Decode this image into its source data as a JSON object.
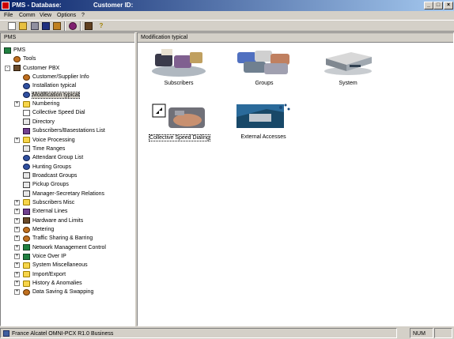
{
  "window": {
    "title": "PMS - Database:",
    "subtitle": "Customer ID:",
    "controls": {
      "minimize": "_",
      "maximize": "□",
      "close": "×"
    }
  },
  "menu": [
    "File",
    "Comm",
    "View",
    "Options",
    "?"
  ],
  "toolbar": {
    "buttons": [
      "new-icon",
      "open-icon",
      "save-icon",
      "save-all-icon",
      "print-icon",
      "disk-icon",
      "book-icon",
      "help-icon"
    ]
  },
  "left_pane": {
    "header": "PMS",
    "tree": [
      {
        "label": "PMS",
        "icon": "pms-icon",
        "level": 0,
        "expander": ""
      },
      {
        "label": "Tools",
        "icon": "tools-icon",
        "level": 1,
        "expander": ""
      },
      {
        "label": "Customer PBX",
        "icon": "pbx-icon",
        "level": 1,
        "expander": "-"
      },
      {
        "label": "Customer/Supplier Info",
        "icon": "gear-icon",
        "level": 2,
        "expander": ""
      },
      {
        "label": "Installation typical",
        "icon": "people-icon",
        "level": 2,
        "expander": ""
      },
      {
        "label": "Modification typical",
        "icon": "people-icon",
        "level": 2,
        "expander": "",
        "selected": true
      },
      {
        "label": "Numbering",
        "icon": "folder-icon",
        "level": 2,
        "expander": "+"
      },
      {
        "label": "Collective Speed Dial",
        "icon": "doc-icon",
        "level": 2,
        "expander": ""
      },
      {
        "label": "Directory",
        "icon": "list-icon",
        "level": 2,
        "expander": ""
      },
      {
        "label": "Subscribers/Basestations List",
        "icon": "phone-icon",
        "level": 2,
        "expander": ""
      },
      {
        "label": "Voice Processing",
        "icon": "folder-icon",
        "level": 2,
        "expander": "+"
      },
      {
        "label": "Time Ranges",
        "icon": "list-icon",
        "level": 2,
        "expander": ""
      },
      {
        "label": "Attendant Group List",
        "icon": "people-icon",
        "level": 2,
        "expander": ""
      },
      {
        "label": "Hunting Groups",
        "icon": "people-icon",
        "level": 2,
        "expander": ""
      },
      {
        "label": "Broadcast Groups",
        "icon": "list-icon",
        "level": 2,
        "expander": ""
      },
      {
        "label": "Pickup Groups",
        "icon": "list-icon",
        "level": 2,
        "expander": ""
      },
      {
        "label": "Manager-Secretary Relations",
        "icon": "list-icon",
        "level": 2,
        "expander": ""
      },
      {
        "label": "Subscribers Misc",
        "icon": "folder-icon",
        "level": 2,
        "expander": "+"
      },
      {
        "label": "External Lines",
        "icon": "phone-icon",
        "level": 2,
        "expander": "+"
      },
      {
        "label": "Hardware and Limits",
        "icon": "pbx-icon",
        "level": 2,
        "expander": "+"
      },
      {
        "label": "Metering",
        "icon": "gear-icon",
        "level": 2,
        "expander": "+"
      },
      {
        "label": "Traffic Sharing & Barring",
        "icon": "gear-icon",
        "level": 2,
        "expander": "+"
      },
      {
        "label": "Network Management Control",
        "icon": "net-icon",
        "level": 2,
        "expander": "+"
      },
      {
        "label": "Voice Over IP",
        "icon": "net-icon",
        "level": 2,
        "expander": "+"
      },
      {
        "label": "System Miscellaneous",
        "icon": "folder-icon",
        "level": 2,
        "expander": "+"
      },
      {
        "label": "Import/Export",
        "icon": "folder-icon",
        "level": 2,
        "expander": "+"
      },
      {
        "label": "History & Anomalies",
        "icon": "folder-icon",
        "level": 2,
        "expander": "+"
      },
      {
        "label": "Data Saving & Swapping",
        "icon": "gear-icon",
        "level": 2,
        "expander": "+"
      }
    ]
  },
  "right_pane": {
    "header": "Modification typical",
    "icons": [
      {
        "label": "Subscribers",
        "image": "subscribers-image"
      },
      {
        "label": "Groups",
        "image": "groups-image"
      },
      {
        "label": "System",
        "image": "system-image"
      },
      {
        "label": "Collective Speed Dialing",
        "image": "speed-dial-image",
        "focused": true
      },
      {
        "label": "External Accesses",
        "image": "external-accesses-image"
      }
    ]
  },
  "status": {
    "text": "France Alcatel OMNI-PCX R1.0 Business",
    "num": "NUM"
  }
}
